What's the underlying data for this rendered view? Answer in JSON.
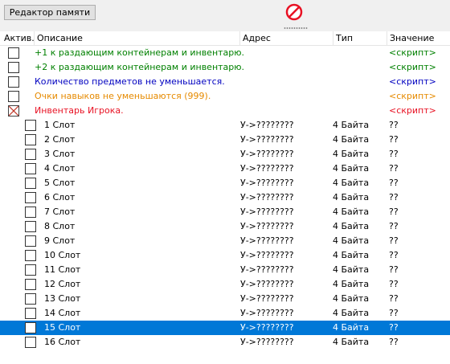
{
  "toolbar": {
    "memory_editor_label": "Редактор памяти",
    "stop_icon": "prohibited-icon",
    "stop_color": "#e81123"
  },
  "columns": {
    "active": "Актив.",
    "description": "Описание",
    "address": "Адрес",
    "type": "Тип",
    "value": "Значение"
  },
  "colors": {
    "green": "#008000",
    "blue": "#0000c0",
    "orange": "#e68a00",
    "red": "#e81123",
    "selection": "#0078d7"
  },
  "scripts": [
    {
      "description": "+1 к раздающим контейнерам и инвентарю.",
      "value": "<скрипт>",
      "color": "#008000",
      "checked": false
    },
    {
      "description": "+2 к раздающим контейнерам и инвентарю.",
      "value": "<скрипт>",
      "color": "#008000",
      "checked": false
    },
    {
      "description": "Количество предметов не уменьшается.",
      "value": "<скрипт>",
      "color": "#0000c0",
      "checked": false
    },
    {
      "description": "Очки навыков не уменьшаются (999).",
      "value": "<скрипт>",
      "color": "#e68a00",
      "checked": false
    },
    {
      "description": "Инвентарь Игрока.",
      "value": "<скрипт>",
      "color": "#e81123",
      "checked": true
    }
  ],
  "slots": [
    {
      "description": "1 Слот",
      "address": "У->????????",
      "type": "4 Байта",
      "value": "??"
    },
    {
      "description": "2 Слот",
      "address": "У->????????",
      "type": "4 Байта",
      "value": "??"
    },
    {
      "description": "3 Слот",
      "address": "У->????????",
      "type": "4 Байта",
      "value": "??"
    },
    {
      "description": "4 Слот",
      "address": "У->????????",
      "type": "4 Байта",
      "value": "??"
    },
    {
      "description": "5 Слот",
      "address": "У->????????",
      "type": "4 Байта",
      "value": "??"
    },
    {
      "description": "6 Слот",
      "address": "У->????????",
      "type": "4 Байта",
      "value": "??"
    },
    {
      "description": "7 Слот",
      "address": "У->????????",
      "type": "4 Байта",
      "value": "??"
    },
    {
      "description": "8 Слот",
      "address": "У->????????",
      "type": "4 Байта",
      "value": "??"
    },
    {
      "description": "9 Слот",
      "address": "У->????????",
      "type": "4 Байта",
      "value": "??"
    },
    {
      "description": "10 Слот",
      "address": "У->????????",
      "type": "4 Байта",
      "value": "??"
    },
    {
      "description": "11 Слот",
      "address": "У->????????",
      "type": "4 Байта",
      "value": "??"
    },
    {
      "description": "12 Слот",
      "address": "У->????????",
      "type": "4 Байта",
      "value": "??"
    },
    {
      "description": "13 Слот",
      "address": "У->????????",
      "type": "4 Байта",
      "value": "??"
    },
    {
      "description": "14 Слот",
      "address": "У->????????",
      "type": "4 Байта",
      "value": "??"
    },
    {
      "description": "15 Слот",
      "address": "У->????????",
      "type": "4 Байта",
      "value": "??",
      "selected": true
    },
    {
      "description": "16 Слот",
      "address": "У->????????",
      "type": "4 Байта",
      "value": "??"
    }
  ]
}
